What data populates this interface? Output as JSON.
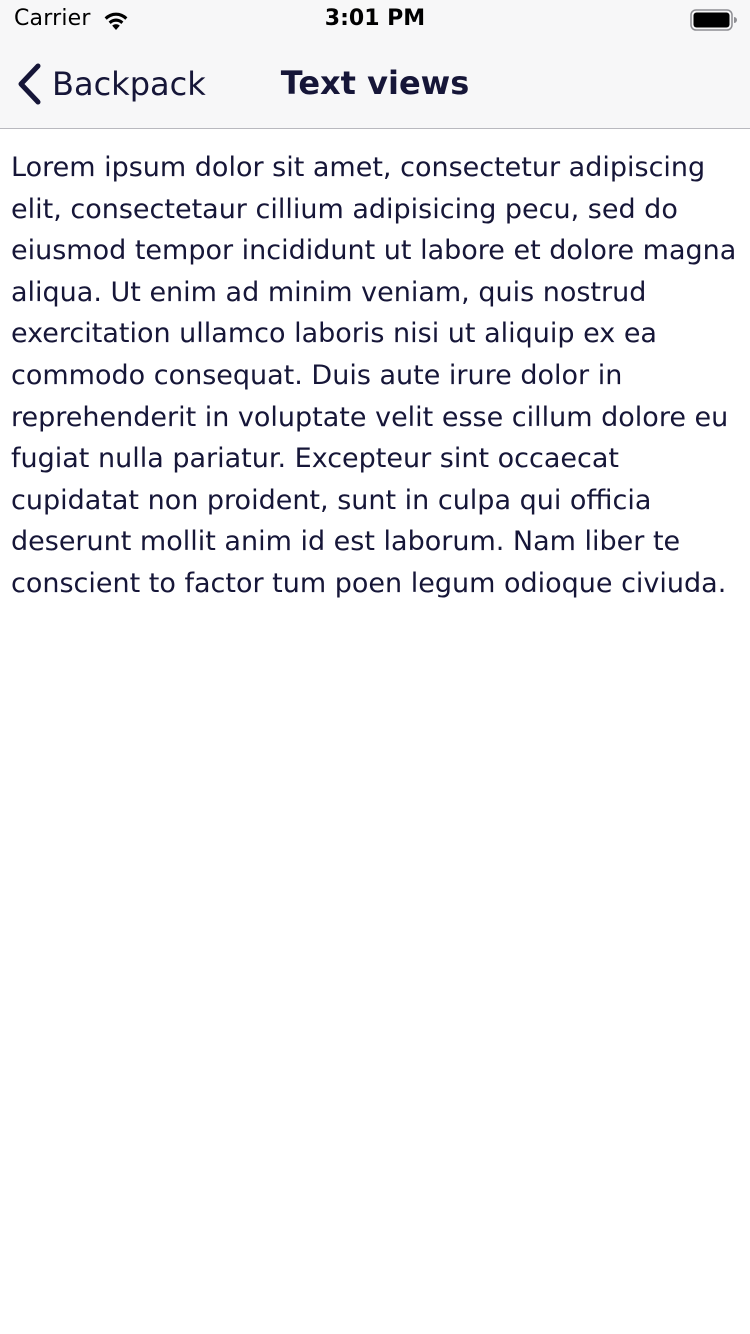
{
  "status_bar": {
    "carrier": "Carrier",
    "time": "3:01 PM",
    "wifi_icon": "wifi-icon",
    "battery_icon": "battery-icon"
  },
  "nav": {
    "back_label": "Backpack",
    "back_icon": "chevron-left-icon",
    "title": "Text views"
  },
  "content": {
    "body_text": "Lorem ipsum dolor sit amet, consectetur adipiscing elit, consectetaur cillium adipisicing pecu, sed do eiusmod tempor incididunt ut labore et dolore magna aliqua. Ut enim ad minim veniam, quis nostrud exercitation ullamco laboris nisi ut aliquip ex ea commodo consequat. Duis aute irure dolor in reprehenderit in voluptate velit esse cillum dolore eu fugiat nulla pariatur. Excepteur sint occaecat cupidatat non proident, sunt in culpa qui officia deserunt mollit anim id est laborum. Nam liber te conscient to factor tum poen legum odioque civiuda."
  },
  "colors": {
    "text": "#161638",
    "nav_background": "#f7f7f8",
    "separator": "#b9b9bf",
    "background": "#ffffff"
  }
}
